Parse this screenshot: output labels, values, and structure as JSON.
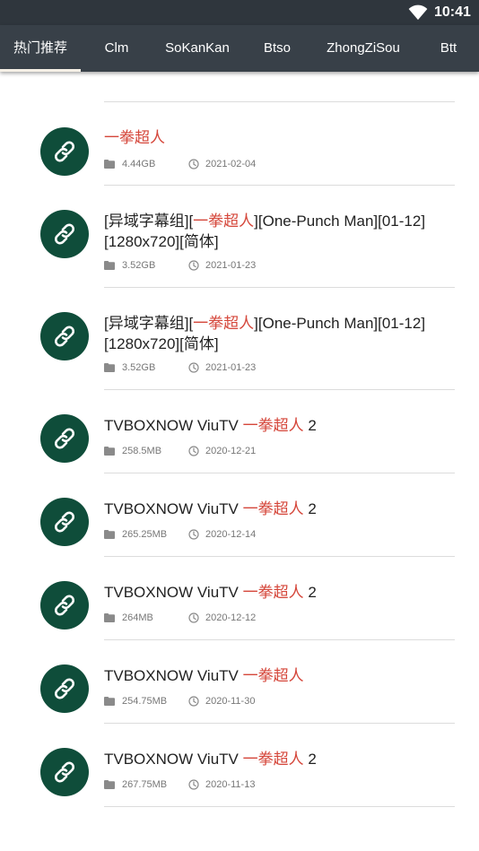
{
  "status_bar": {
    "time": "10:41"
  },
  "tabs": [
    {
      "label": "热门推荐",
      "active": true
    },
    {
      "label": "Clm",
      "active": false
    },
    {
      "label": "SoKanKan",
      "active": false
    },
    {
      "label": "Btso",
      "active": false
    },
    {
      "label": "ZhongZiSou",
      "active": false
    },
    {
      "label": "Btt",
      "active": false
    }
  ],
  "colors": {
    "highlight": "#d5473b",
    "avatar": "#0f4d3a",
    "tab_bar": "#384048"
  },
  "items": [
    {
      "title_pre": "",
      "title_hl": "一拳超人",
      "title_post": "",
      "size": "4.44GB",
      "date": "2021-02-04"
    },
    {
      "title_pre": "[异域字幕组][",
      "title_hl": "一拳超人",
      "title_post": "][One-Punch Man][01-12][1280x720][简体]",
      "size": "3.52GB",
      "date": "2021-01-23"
    },
    {
      "title_pre": "[异域字幕组][",
      "title_hl": "一拳超人",
      "title_post": "][One-Punch Man][01-12][1280x720][简体]",
      "size": "3.52GB",
      "date": "2021-01-23"
    },
    {
      "title_pre": "TVBOXNOW ViuTV ",
      "title_hl": "一拳超人",
      "title_post": " 2",
      "size": "258.5MB",
      "date": "2020-12-21"
    },
    {
      "title_pre": "TVBOXNOW ViuTV ",
      "title_hl": "一拳超人",
      "title_post": " 2",
      "size": "265.25MB",
      "date": "2020-12-14"
    },
    {
      "title_pre": "TVBOXNOW ViuTV ",
      "title_hl": "一拳超人",
      "title_post": " 2",
      "size": "264MB",
      "date": "2020-12-12"
    },
    {
      "title_pre": "TVBOXNOW ViuTV ",
      "title_hl": "一拳超人",
      "title_post": "",
      "size": "254.75MB",
      "date": "2020-11-30"
    },
    {
      "title_pre": "TVBOXNOW ViuTV ",
      "title_hl": "一拳超人",
      "title_post": " 2",
      "size": "267.75MB",
      "date": "2020-11-13"
    }
  ]
}
